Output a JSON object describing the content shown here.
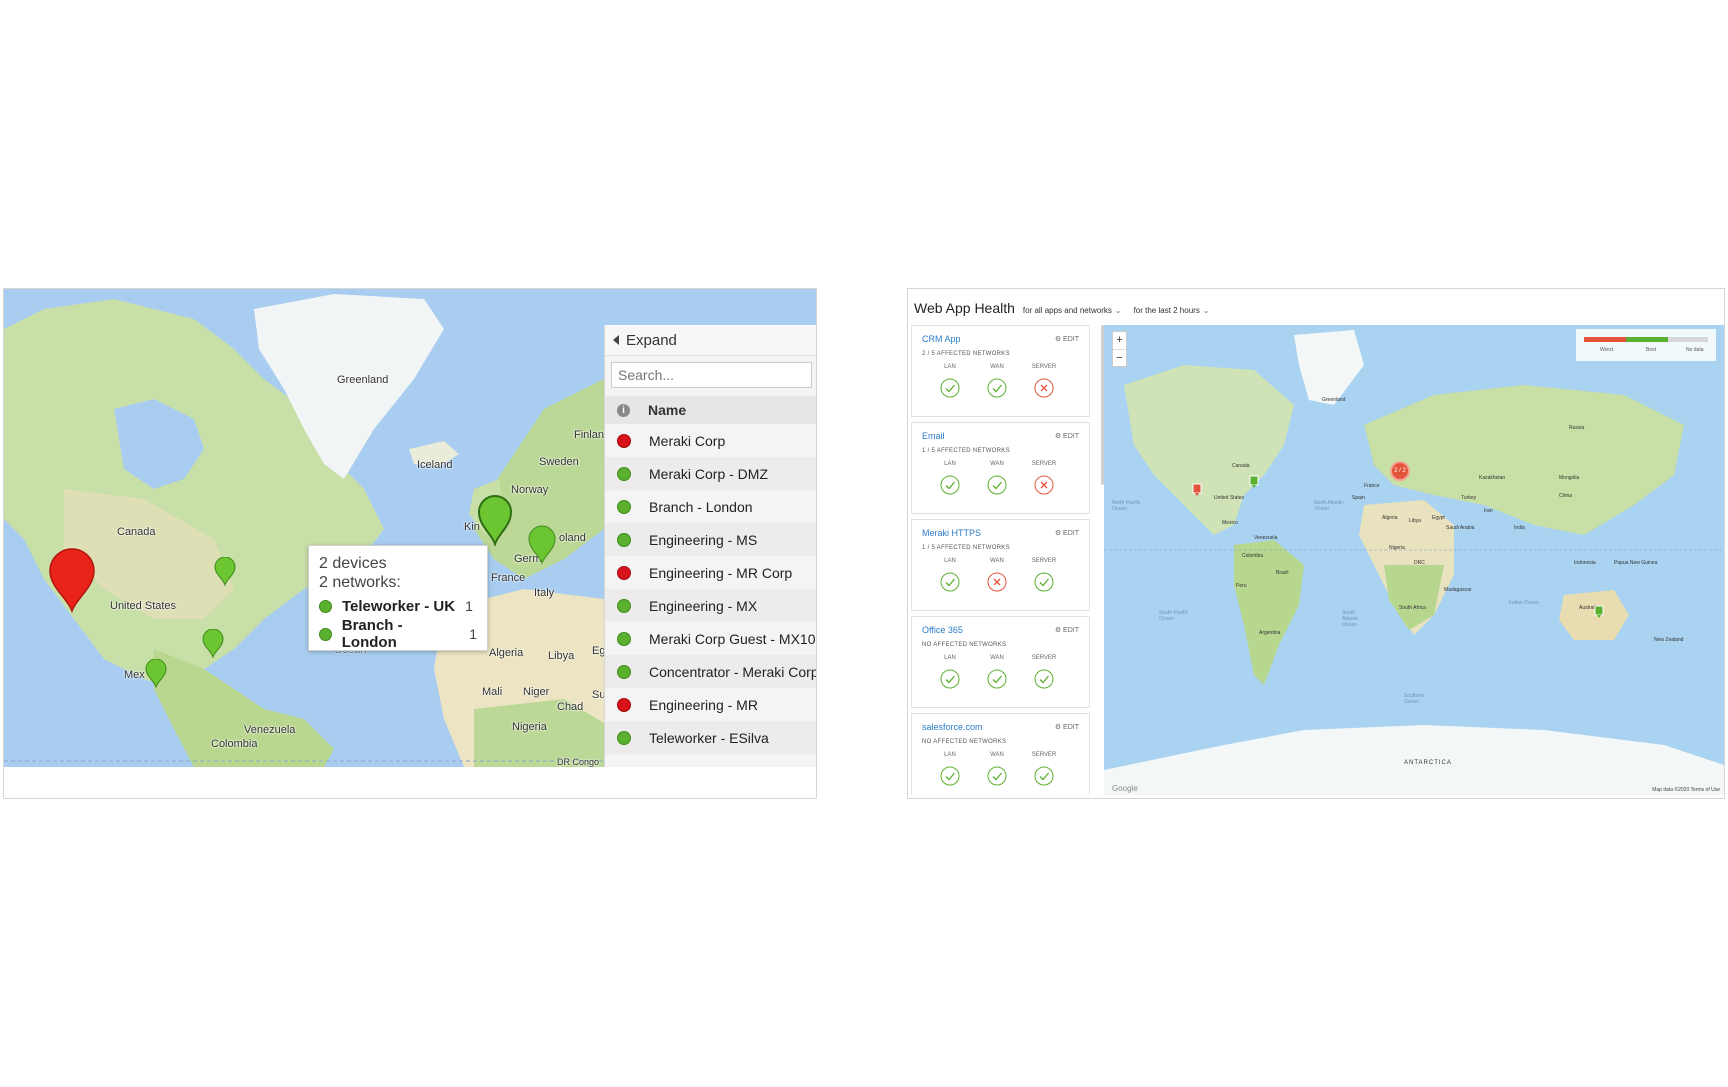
{
  "left_panel": {
    "map_labels": {
      "greenland": "Greenland",
      "iceland": "Iceland",
      "canada": "Canada",
      "united_states": "United States",
      "mexico": "Mex",
      "norway": "Norway",
      "sweden": "Sweden",
      "finland": "Finlan",
      "uk": "Kin",
      "france": "France",
      "germany": "Germ",
      "poland": "oland",
      "italy": "Italy",
      "algeria": "Algeria",
      "libya": "Libya",
      "egypt": "Eg",
      "mali": "Mali",
      "niger": "Niger",
      "chad": "Chad",
      "sudan": "Su",
      "nigeria": "Nigeria",
      "venezuela": "Venezuela",
      "colombia": "Colombia",
      "ocean": "Ocean",
      "drc": "DR Congo"
    },
    "tooltip": {
      "devices": "2 devices",
      "networks": "2 networks:",
      "items": [
        {
          "name": "Teleworker - UK",
          "count": "1"
        },
        {
          "name": "Branch - London",
          "count": "1"
        }
      ]
    },
    "network_list": {
      "expand_label": "Expand",
      "search_placeholder": "Search...",
      "header_name": "Name",
      "info_icon": "i",
      "rows": [
        {
          "name": "Meraki Corp",
          "status": "red"
        },
        {
          "name": "Meraki Corp - DMZ",
          "status": "green"
        },
        {
          "name": "Branch - London",
          "status": "green"
        },
        {
          "name": "Engineering - MS",
          "status": "green"
        },
        {
          "name": "Engineering - MR Corp",
          "status": "red"
        },
        {
          "name": "Engineering - MX",
          "status": "green"
        },
        {
          "name": "Meraki Corp Guest - MX100",
          "status": "green"
        },
        {
          "name": "Concentrator - Meraki Corp",
          "status": "green"
        },
        {
          "name": "Engineering - MR",
          "status": "red"
        },
        {
          "name": "Teleworker - ESilva",
          "status": "green"
        }
      ]
    },
    "colors": {
      "status_green": "#5cb030",
      "status_red": "#d9121a",
      "pin_red": "#e8231a",
      "pin_green": "#6cc631"
    }
  },
  "right_panel": {
    "title": "Web App Health",
    "filter_apps": "for all apps and networks",
    "filter_time": "for the last 2 hours",
    "column_labels": {
      "lan": "LAN",
      "wan": "WAN",
      "server": "SERVER"
    },
    "edit_label": "EDIT",
    "apps": [
      {
        "name": "CRM App",
        "affected": "2 / 5 AFFECTED NETWORKS",
        "lan": "ok",
        "wan": "ok",
        "server": "fail"
      },
      {
        "name": "Email",
        "affected": "1 / 5 AFFECTED NETWORKS",
        "lan": "ok",
        "wan": "ok",
        "server": "fail"
      },
      {
        "name": "Meraki HTTPS",
        "affected": "1 / 5 AFFECTED NETWORKS",
        "lan": "ok",
        "wan": "fail",
        "server": "ok"
      },
      {
        "name": "Office 365",
        "affected": "NO AFFECTED NETWORKS",
        "lan": "ok",
        "wan": "ok",
        "server": "ok"
      },
      {
        "name": "salesforce.com",
        "affected": "NO AFFECTED NETWORKS",
        "lan": "ok",
        "wan": "ok",
        "server": "ok"
      }
    ],
    "zoom_in": "+",
    "zoom_out": "−",
    "legend": {
      "worst": "Worst",
      "best": "Best",
      "no_data": "No data"
    },
    "cluster_label": "2 / 2",
    "map_labels": {
      "greenland": "Greenland",
      "canada": "Canada",
      "united_states": "United States",
      "mexico": "Mexico",
      "brazil": "Brazil",
      "argentina": "Argentina",
      "russia": "Russia",
      "china": "China",
      "india": "India",
      "australia": "Australia",
      "antarctica": "ANTARCTICA",
      "north_pacific": "North Pacific Ocean",
      "south_pacific": "South Pacific Ocean",
      "north_atlantic": "North Atlantic Ocean",
      "south_atlantic": "South Atlantic Ocean",
      "indian_ocean": "Indian Ocean",
      "southern_ocean": "Southern Ocean",
      "kazakhstan": "Kazakhstan",
      "mongolia": "Mongolia",
      "algeria": "Algeria",
      "libya": "Libya",
      "egypt": "Egypt",
      "nigeria": "Nigeria",
      "drc": "DRC",
      "south_africa": "South Africa",
      "madagascar": "Madagascar",
      "iran": "Iran",
      "saudi_arabia": "Saudi Arabia",
      "indonesia": "Indonesia",
      "new_zealand": "New Zealand",
      "peru": "Peru",
      "colombia": "Colombia",
      "venezuela": "Venezuela",
      "spain": "Spain",
      "france": "France",
      "turkey": "Turkey",
      "papua": "Papua New Guinea"
    },
    "attribution": "Map data ©2020  Terms of Use",
    "google": "Google",
    "colors": {
      "link": "#2a7ac7",
      "ok": "#5cb030",
      "fail": "#e4543c",
      "ocean": "#a9d3f0"
    }
  }
}
